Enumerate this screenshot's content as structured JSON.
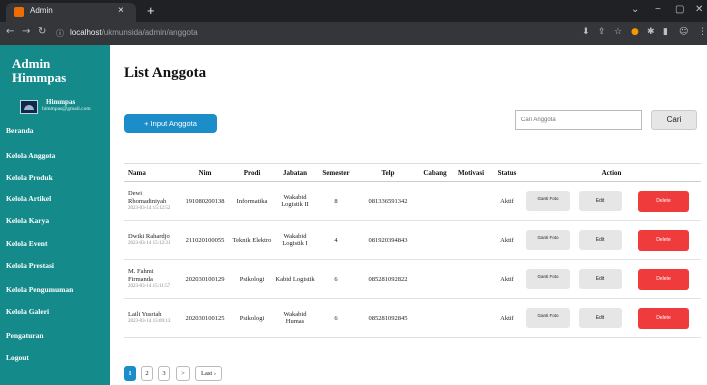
{
  "browser": {
    "tab_title": "Admin",
    "tab_close": "×",
    "new_tab": "+",
    "url_host": "localhost",
    "url_path": "/ukmunsida/admin/anggota",
    "window_controls": [
      "⌄",
      "−",
      "▢",
      "✕"
    ],
    "nav_icons": [
      "back-icon",
      "forward-icon",
      "reload-icon",
      "info-icon"
    ],
    "extension_icons": [
      "download-icon",
      "share-icon",
      "bookmark-star-icon",
      "extension-icon",
      "puzzle-icon",
      "sidebar-icon",
      "profile-icon",
      "menu-icon"
    ]
  },
  "sidebar": {
    "brand": "Admin Himmpas",
    "user_name": "Himmpas",
    "user_email": "himmpas@gmail.com",
    "items": [
      {
        "label": "Beranda"
      },
      {
        "label": "Kelola Anggota"
      },
      {
        "label": "Kelola Produk"
      },
      {
        "label": "Kelola Artikel"
      },
      {
        "label": "Kelola Karya"
      },
      {
        "label": "Kelola Event"
      },
      {
        "label": "Kelola Prestasi"
      },
      {
        "label": "Kelola Pengumuman"
      },
      {
        "label": "Kelola Galeri"
      },
      {
        "label": "Pengaturan"
      },
      {
        "label": "Logout"
      }
    ]
  },
  "main": {
    "title": "List Anggota",
    "input_button": "+ Input Anggota",
    "search_placeholder": "Cari Anggota",
    "search_button": "Cari"
  },
  "table": {
    "headers": [
      "Nama",
      "Nim",
      "Prodi",
      "Jabatan",
      "Semester",
      "Telp",
      "Cabang",
      "Motivasi",
      "Status",
      "Action"
    ],
    "rows": [
      {
        "nama": "Dewi Rhomadiniyah",
        "date": "2023-03-14 15:12:52",
        "nim": "191080200138",
        "prodi": "Informatika",
        "jabatan": "Wakabid Logistik II",
        "semester": "8",
        "telp": "081336591342",
        "cabang": "",
        "motivasi": "",
        "status": "Aktif"
      },
      {
        "nama": "Dwiki Rahardjo",
        "date": "2023-03-14 15:12:31",
        "nim": "211020100055",
        "prodi": "Teknik Elektro",
        "jabatan": "Wakabid Logistik I",
        "semester": "4",
        "telp": "081920394843",
        "cabang": "",
        "motivasi": "",
        "status": "Aktif"
      },
      {
        "nama": "M. Fahmi Firmanda",
        "date": "2023-03-14 15:11:57",
        "nim": "202030100129",
        "prodi": "Psikologi",
        "jabatan": "Kabid Logistik",
        "semester": "6",
        "telp": "085281092822",
        "cabang": "",
        "motivasi": "",
        "status": "Aktif"
      },
      {
        "nama": "Laili Yusriah",
        "date": "2023-03-14 15:09:13",
        "nim": "202030100125",
        "prodi": "Psikologi",
        "jabatan": "Wakabid Humas",
        "semester": "6",
        "telp": "085281092845",
        "cabang": "",
        "motivasi": "",
        "status": "Aktif"
      }
    ],
    "action_labels": {
      "ganti": "Ganti Foto",
      "edit": "Edit",
      "delete": "Delete"
    }
  },
  "pagination": {
    "pages": [
      "1",
      "2",
      "3"
    ],
    "current": "1",
    "next": ">",
    "last": "Last ›"
  },
  "colors": {
    "sidebar": "#148a8a",
    "primary": "#1b8dc9",
    "danger": "#ef3b3b",
    "status_active": "#2d9b2d"
  }
}
